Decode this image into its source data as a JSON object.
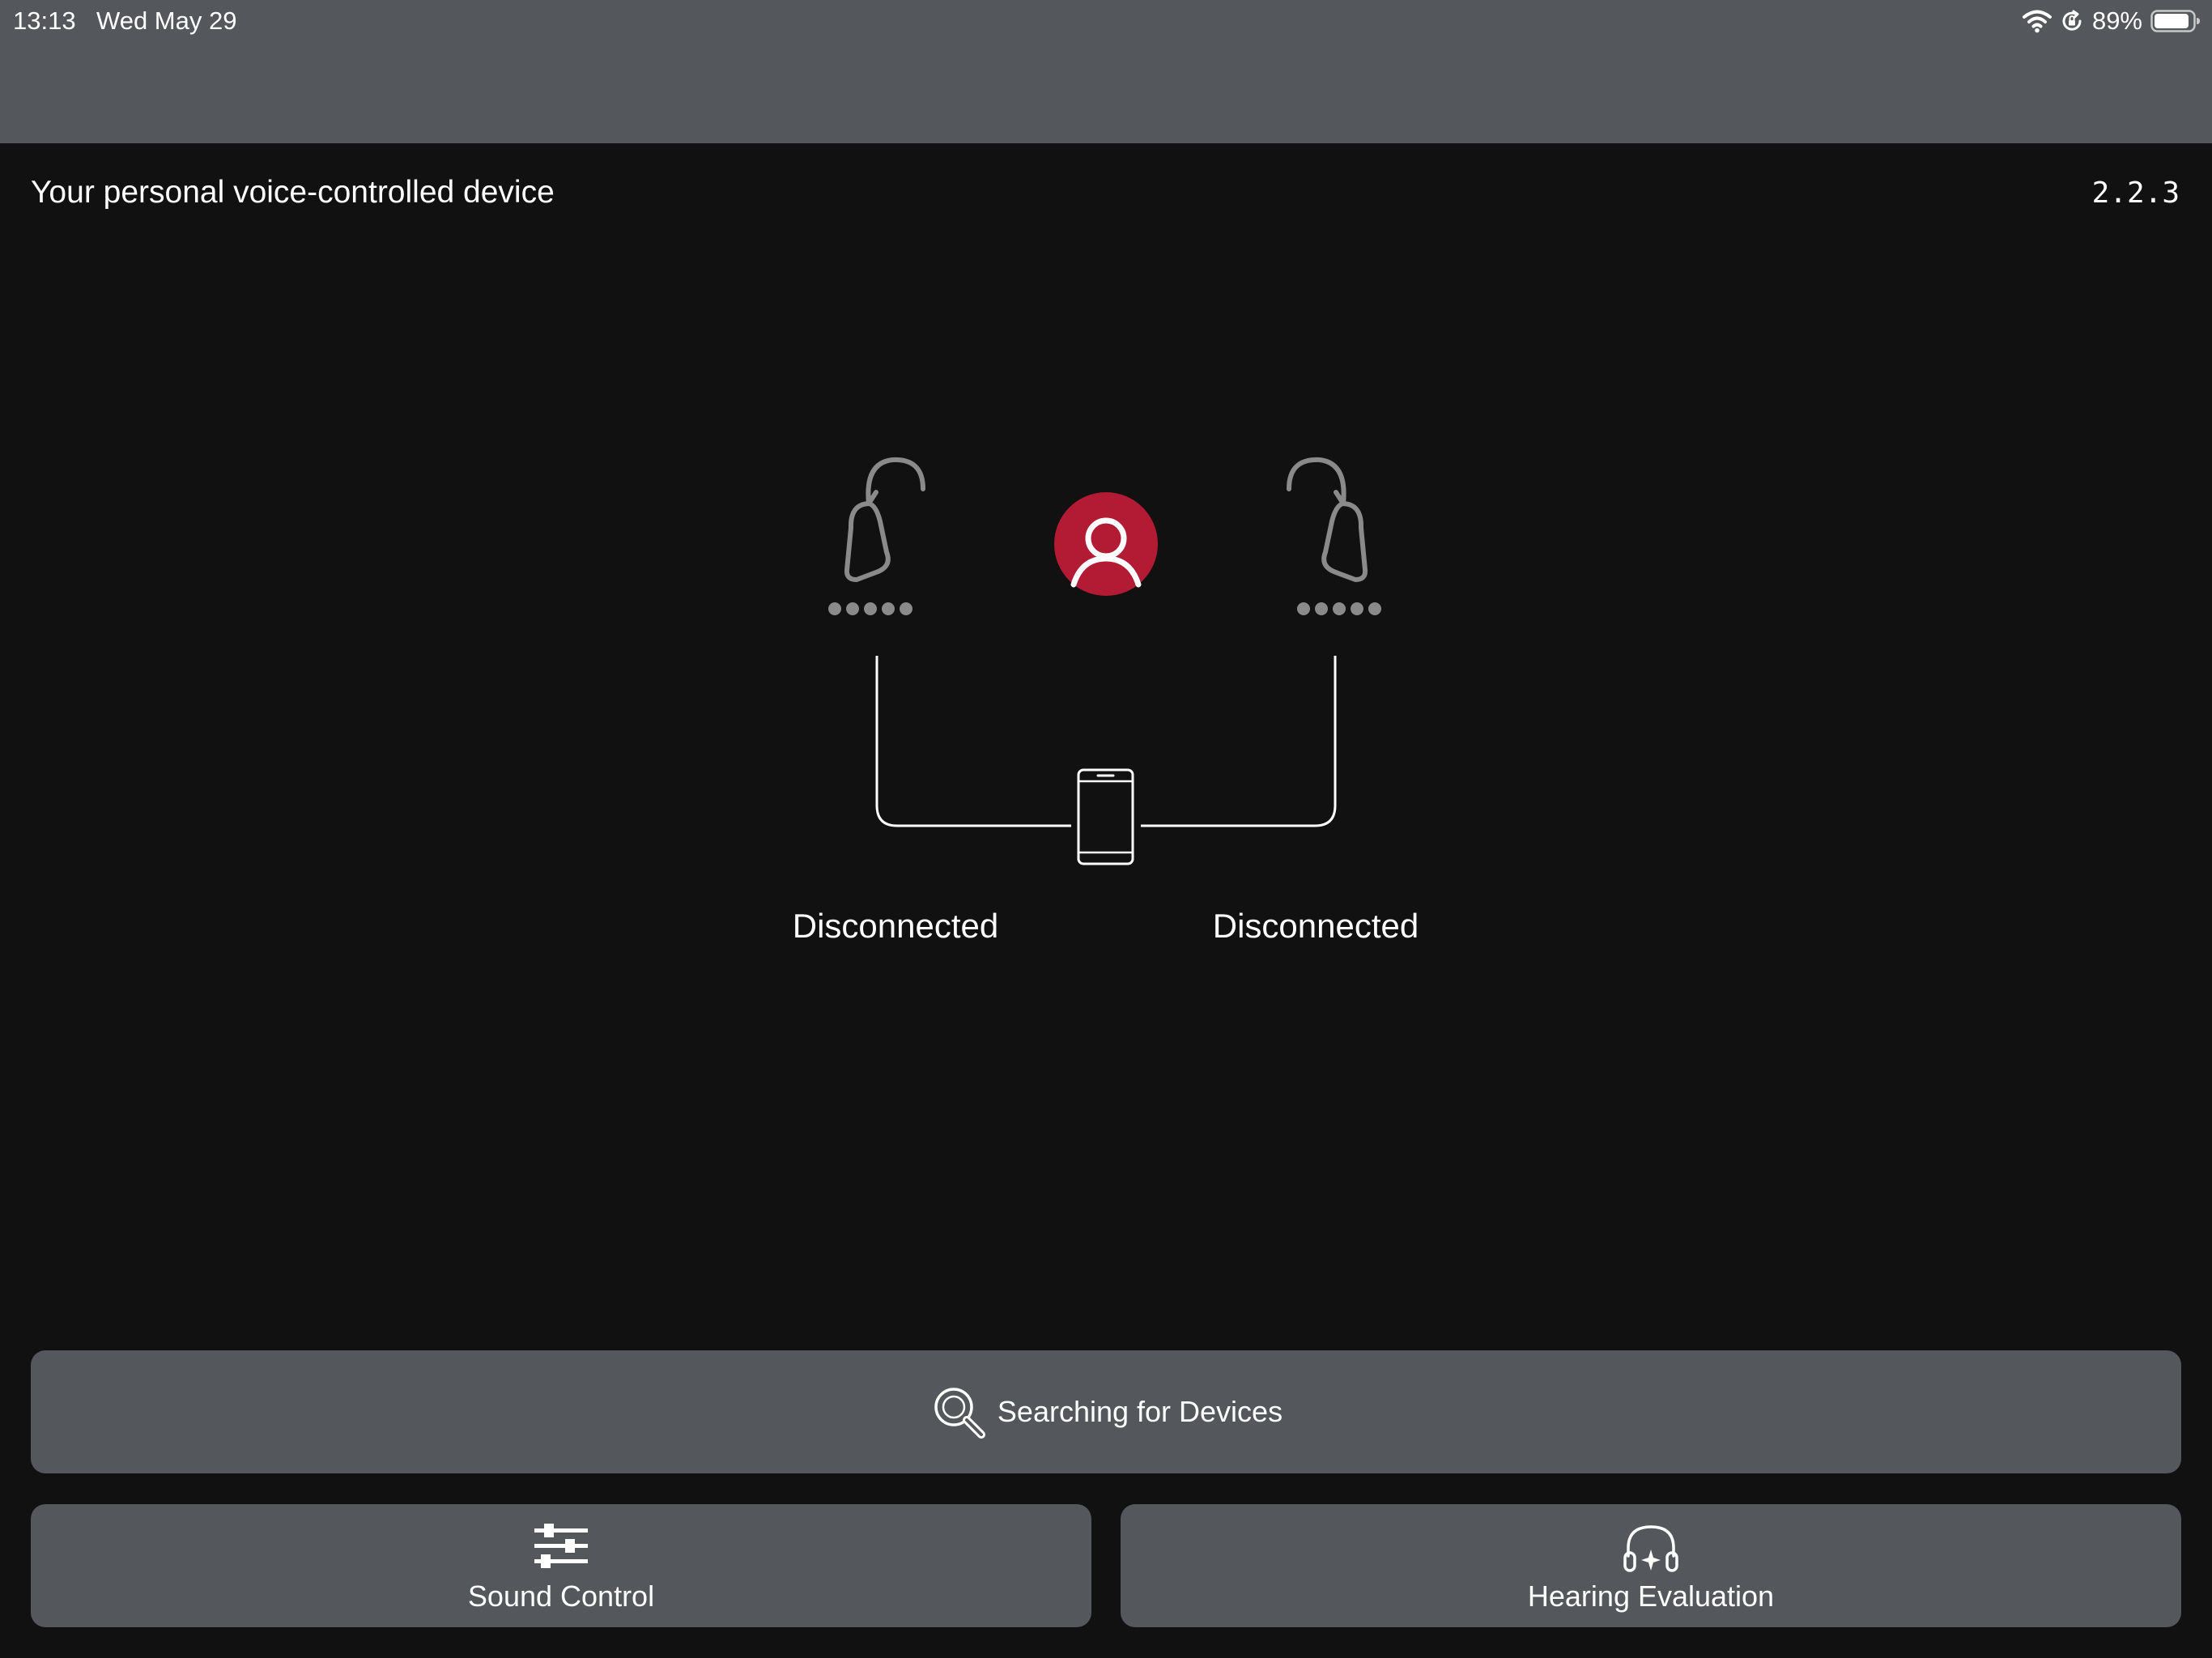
{
  "status_bar": {
    "time": "13:13",
    "date": "Wed May 29",
    "battery_percent": "89%",
    "icons": [
      "wifi-icon",
      "orientation-lock-icon",
      "battery-icon"
    ]
  },
  "header": {
    "subtitle": "Your personal voice-controlled device",
    "version": "2.2.3"
  },
  "devices": {
    "left": {
      "icon": "hearing-aid-icon",
      "status": "Disconnected",
      "signal_dots": 5
    },
    "right": {
      "icon": "hearing-aid-icon",
      "status": "Disconnected",
      "signal_dots": 5
    },
    "center_icon": "user-profile-icon",
    "phone_icon": "phone-icon"
  },
  "actions": {
    "search": {
      "label": "Searching for Devices",
      "icon": "magnifier-icon"
    },
    "sound_control": {
      "label": "Sound Control",
      "icon": "sliders-icon"
    },
    "hearing_evaluation": {
      "label": "Hearing Evaluation",
      "icon": "headphones-icon"
    }
  },
  "colors": {
    "background": "#111112",
    "header_band": "#54575c",
    "button": "#54575c",
    "accent_red": "#b31b34",
    "device_gray": "#8a8a8a",
    "text": "#ffffff"
  }
}
